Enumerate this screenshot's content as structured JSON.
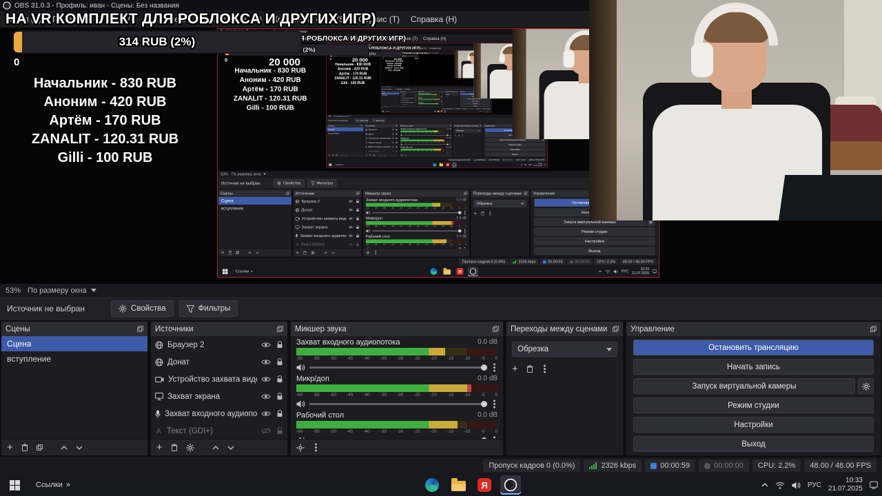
{
  "colors": {
    "accent": "#3e5ba9",
    "progress_yellow": "#eda93f"
  },
  "overlay": {
    "title": "НА VR КОМПЛЕКТ ДЛЯ РОБЛОКСА И ДРУГИХ ИГР)",
    "progress_label": "314 RUB (2%)",
    "scale_min": "0",
    "scale_max": "20 000",
    "donors": [
      "Начальник - 830 RUB",
      "Аноним - 420 RUB",
      "Артём - 170 RUB",
      "ZANALIT - 120.31 RUB",
      "Gilli - 100 RUB"
    ]
  },
  "obs": {
    "window_title": "OBS 31.0.3 - Профиль: иван - Сцены: Без названия",
    "menu": [
      "Файл (F)",
      "Правка (E)",
      "Вид (V)",
      "Док-панели (D)",
      "Профиль (P)",
      "Коллекция сцен (S)",
      "Сервис (Т)",
      "Справка (Н)"
    ],
    "zoom": {
      "level": "53%",
      "fit": "По размеру окна"
    },
    "source_toolbar": {
      "status": "Источник не выбран",
      "properties": "Свойства",
      "filters": "Фильтры"
    },
    "scenes": {
      "title": "Сцены",
      "items": [
        "Сцена",
        "вступление"
      ]
    },
    "sources": {
      "title": "Источники",
      "items": [
        "Браузер 2",
        "Донат",
        "Устройство захвата видео",
        "Захват экрана",
        "Захват входного аудиопот",
        "Текст (GDI+)"
      ]
    },
    "mixer": {
      "title": "Микшер звука",
      "ticks": [
        "-60",
        "-55",
        "-50",
        "-45",
        "-40",
        "-35",
        "-30",
        "-25",
        "-20",
        "-15",
        "-10",
        "-5",
        "0"
      ],
      "channels": [
        {
          "name": "Захват входного аудиопотока",
          "db": "0.0 dB"
        },
        {
          "name": "Микр/доп",
          "db": "0.0 dB"
        },
        {
          "name": "Рабочий стол",
          "db": "0.0 dB"
        }
      ]
    },
    "transitions": {
      "title": "Переходы между сценами",
      "current": "Обрезка"
    },
    "controls": {
      "title": "Управление",
      "stop_stream": "Остановить трансляцию",
      "start_record": "Начать запись",
      "virtual_cam": "Запуск виртуальной камеры",
      "studio_mode": "Режим студии",
      "settings": "Настройки",
      "exit": "Выход"
    },
    "status": {
      "dropped": "Пропуск кадров 0 (0.0%)",
      "bitrate": "2326 kbps",
      "stream_time": "00:00:59",
      "record_time": "00:00:00",
      "cpu": "CPU: 2.2%",
      "fps": "48.00 / 48.00 FPS"
    }
  },
  "taskbar": {
    "links": "Ссылки",
    "links_chevron": "»",
    "yandex_letter": "Я",
    "lang": "РУС",
    "time": "10:33",
    "date": "21.07.2025"
  }
}
